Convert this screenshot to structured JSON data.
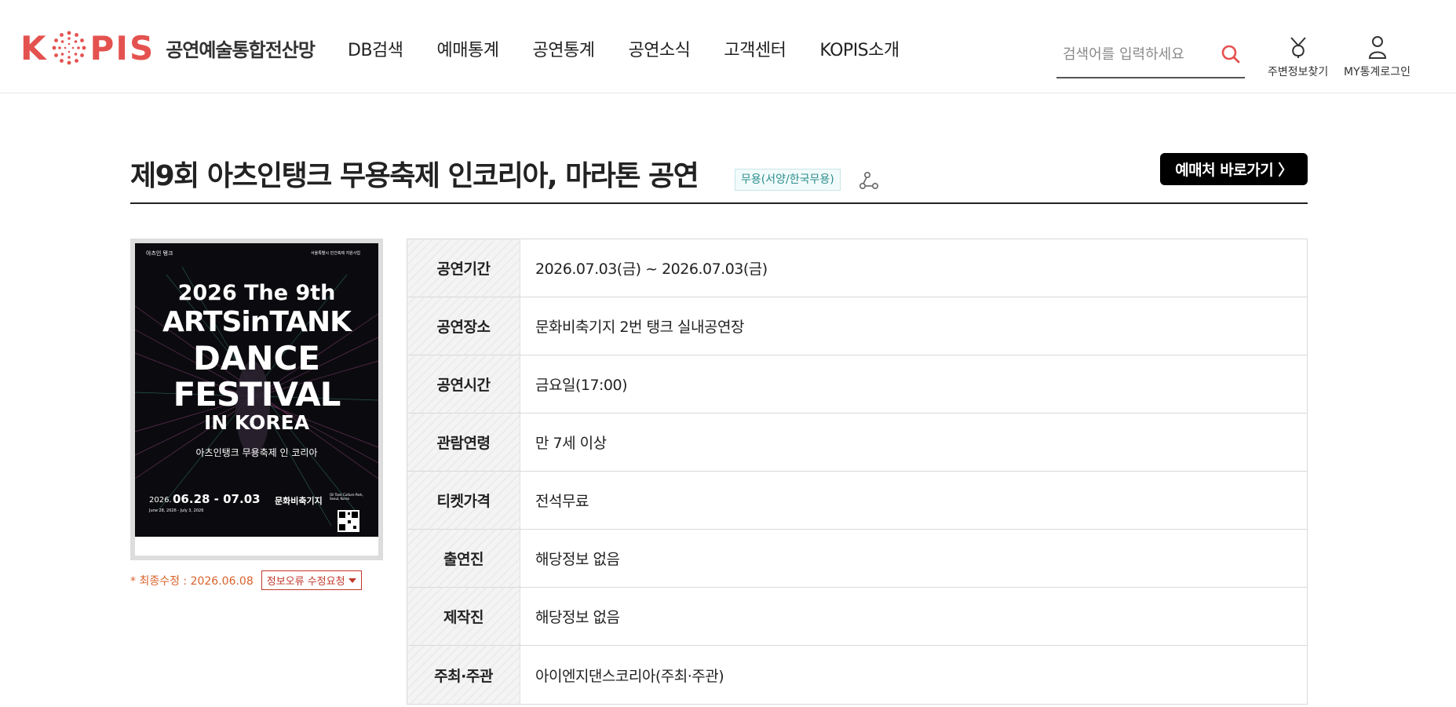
{
  "header": {
    "logo_text": "KOPIS",
    "logo_subtitle": "공연예술통합전산망",
    "nav": [
      {
        "label": "DB검색"
      },
      {
        "label": "예매통계"
      },
      {
        "label": "공연통계"
      },
      {
        "label": "공연소식"
      },
      {
        "label": "고객센터"
      },
      {
        "label": "KOPIS소개"
      }
    ],
    "search": {
      "placeholder": "검색어를 입력하세요",
      "value": ""
    },
    "util": {
      "nearby_label": "주변정보찾기",
      "my_label": "MY통계로그인"
    }
  },
  "performance": {
    "title": "제9회 아츠인탱크 무용축제 인코리아, 마라톤 공연",
    "genre": "무용(서양/한국무용)",
    "booking_label": "예매처 바로가기 〉",
    "last_updated": "* 최종수정 : 2026.06.08",
    "report_label": "정보오류 수정요청",
    "poster": {
      "brand": "아츠인 탱크",
      "sponsor_note": "서울특별시 민간축제 지원사업",
      "line1": "2026 The 9th",
      "line2": "ARTSinTANK",
      "line3": "DANCE",
      "line4": "FESTIVAL",
      "line5": "IN KOREA",
      "korean_title": "아츠인탱크 무용축제 인 코리아",
      "date_prefix": "2026.",
      "date_range": "06.28 - 07.03",
      "date_en": "June 28, 2026 - July 3, 2026",
      "venue": "문화비축기지",
      "venue_en": "Oil Tank Culture Park, Seoul, Korea"
    }
  },
  "info": [
    {
      "label": "공연기간",
      "value": "2026.07.03(금) ~ 2026.07.03(금)"
    },
    {
      "label": "공연장소",
      "value": "문화비축기지 2번 탱크 실내공연장"
    },
    {
      "label": "공연시간",
      "value": "금요일(17:00)"
    },
    {
      "label": "관람연령",
      "value": "만 7세 이상"
    },
    {
      "label": "티켓가격",
      "value": "전석무료"
    },
    {
      "label": "출연진",
      "value": "해당정보 없음"
    },
    {
      "label": "제작진",
      "value": "해당정보 없음"
    },
    {
      "label": "주최·주관",
      "value": "아이엔지댄스코리아(주최·주관)"
    }
  ],
  "colors": {
    "brand_red": "#e4524f",
    "accent_orange": "#d8622a",
    "report_red": "#c0392b",
    "genre_teal": "#2a8c8c"
  },
  "icons": {
    "search": "search-icon",
    "nearby": "map-pin-icon",
    "my": "user-icon",
    "share": "share-icon"
  }
}
